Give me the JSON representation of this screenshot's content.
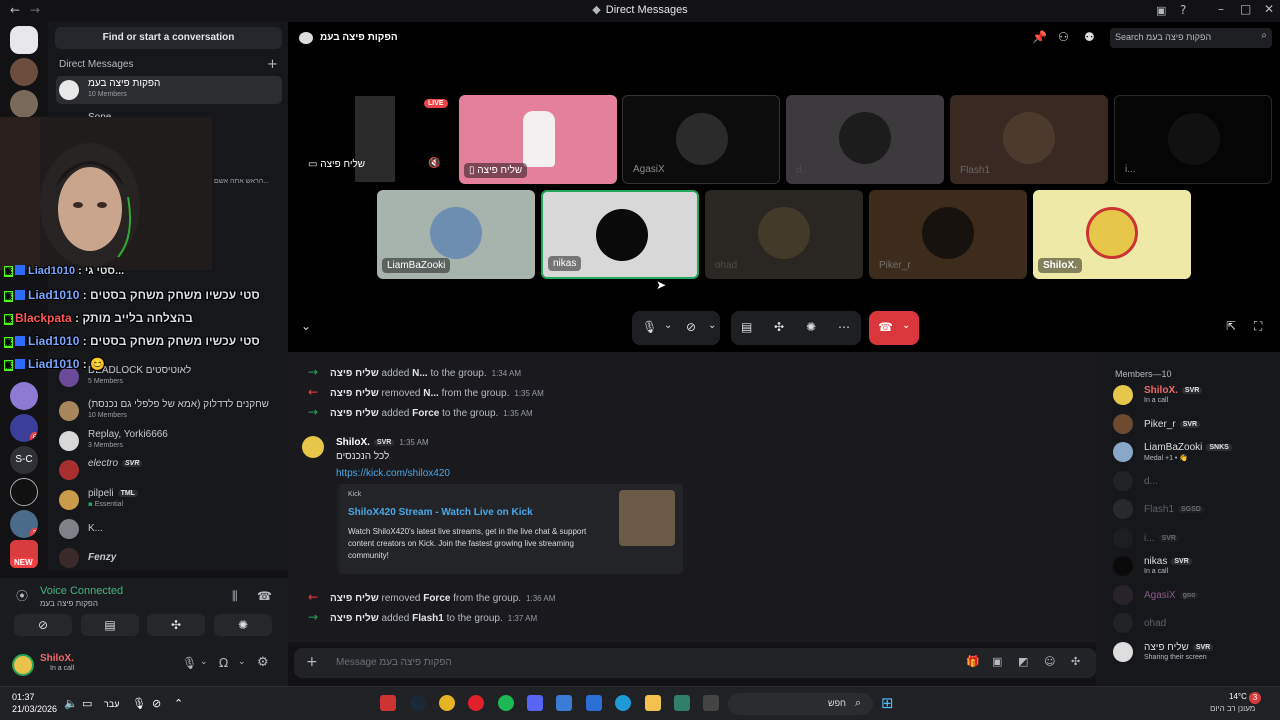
{
  "window": {
    "title": "Direct Messages"
  },
  "server_rail": {
    "servers": [
      {
        "label": "S-C",
        "badge": ""
      },
      {
        "label": "",
        "badge": "6"
      },
      {
        "label": "",
        "badge": "3"
      },
      {
        "label": "NEW",
        "badge": ""
      }
    ]
  },
  "dm_panel": {
    "find_button": "Find or start a conversation",
    "header": "Direct Messages",
    "add_icon": "+",
    "items": [
      {
        "name": "הפקות פיצה בעמ",
        "sub": "10 Members",
        "tag": ""
      },
      {
        "name": "DEADLOCK לאוטיסטים",
        "sub": "5 Members",
        "tag": ""
      },
      {
        "name": "שחקנים לדדלוק (אמא של פלפלי גם נכנסת)",
        "sub": "10 Members",
        "tag": ""
      },
      {
        "name": "Replay, Yorki6666",
        "sub": "3 Members",
        "tag": ""
      },
      {
        "name": "electro",
        "sub": "",
        "tag": "SVR"
      },
      {
        "name": "pilpeli",
        "sub": "Essential",
        "tag": "TML"
      },
      {
        "name": "K...",
        "sub": "",
        "tag": ""
      },
      {
        "name": "Fenzy",
        "sub": "",
        "tag": ""
      }
    ],
    "overlay_partial": [
      "Sone",
      "הראש אתה אשם..."
    ]
  },
  "stream_chat_overlay": [
    {
      "user": "Liad1010",
      "color": "b",
      "msg": "סטי גי..."
    },
    {
      "user": "Liad1010",
      "color": "b",
      "msg": "סטי עכשיו משחק משחק בסטים"
    },
    {
      "user": "Blackpata",
      "color": "r",
      "msg": "בהצלחה בלייב מותק"
    },
    {
      "user": "Liad1010",
      "color": "b",
      "msg": "סטי עכשיו משחק משחק בסטים"
    },
    {
      "user": "Liad1010",
      "color": "b",
      "msg": "😊"
    }
  ],
  "voice": {
    "status": "Voice Connected",
    "channel": "הפקות פיצה בעמ"
  },
  "user_bar": {
    "name": "ShiloX.",
    "status": "In a call"
  },
  "stage": {
    "header_title": "הפקות פיצה בעמ",
    "search_placeholder": "Search הפקות פיצה בעמ",
    "live_badge": "LIVE",
    "screen_share_label": "שליח פיצה",
    "tiles": [
      {
        "name": "שליח פיצה",
        "style": "pink"
      },
      {
        "name": "AgasiX",
        "style": "dim"
      },
      {
        "name": "d...",
        "style": "dim"
      },
      {
        "name": "Flash1",
        "style": "dim"
      },
      {
        "name": "i...",
        "style": "dim"
      },
      {
        "name": "LiamBaZooki",
        "style": "normal"
      },
      {
        "name": "nikas",
        "style": "selected"
      },
      {
        "name": "ohad",
        "style": "dim"
      },
      {
        "name": "Piker_r",
        "style": "dim"
      },
      {
        "name": "ShiloX.",
        "style": "yellow"
      }
    ]
  },
  "chat": {
    "events": [
      {
        "kind": "add",
        "actor": "שליח פיצה",
        "verb": "added",
        "target": "N...",
        "tail": "to the group.",
        "time": "1:34 AM"
      },
      {
        "kind": "remove",
        "actor": "שליח פיצה",
        "verb": "removed",
        "target": "N...",
        "tail": "from the group.",
        "time": "1:35 AM"
      },
      {
        "kind": "add",
        "actor": "שליח פיצה",
        "verb": "added",
        "target": "Force",
        "tail": "to the group.",
        "time": "1:35 AM"
      }
    ],
    "message": {
      "author": "ShiloX.",
      "tag": "SVR",
      "time": "1:35 AM",
      "text": "לכל הנכנסים",
      "link": "https://kick.com/shilox420",
      "embed": {
        "provider": "Kick",
        "title": "ShiloX420 Stream - Watch Live on Kick",
        "description": "Watch ShiloX420's latest live streams, get in the live chat & support content creators on Kick. Join the fastest growing live streaming community!"
      }
    },
    "events2": [
      {
        "kind": "remove",
        "actor": "שליח פיצה",
        "verb": "removed",
        "target": "Force",
        "tail": "from the group.",
        "time": "1:36 AM"
      },
      {
        "kind": "add",
        "actor": "שליח פיצה",
        "verb": "added",
        "target": "Flash1",
        "tail": "to the group.",
        "time": "1:37 AM"
      }
    ],
    "composer_placeholder": "Message הפקות פיצה בעמ"
  },
  "members": {
    "header": "Members—10",
    "list": [
      {
        "name": "ShiloX.",
        "tag": "SVR",
        "status": "In a call",
        "color": "#f0696b",
        "off": false
      },
      {
        "name": "Piker_r",
        "tag": "SVR",
        "status": "",
        "color": "#dbdee1",
        "off": false
      },
      {
        "name": "LiamBaZooki",
        "tag": "SNKS",
        "status": "Medal +1 • 👋",
        "color": "#dbdee1",
        "off": false
      },
      {
        "name": "d...",
        "tag": "",
        "status": "",
        "color": "",
        "off": true
      },
      {
        "name": "Flash1",
        "tag": "SGSD",
        "status": "",
        "color": "",
        "off": true
      },
      {
        "name": "i...",
        "tag": "SVR",
        "status": "",
        "color": "",
        "off": true
      },
      {
        "name": "nikas",
        "tag": "SVR",
        "status": "In a call",
        "color": "#dbdee1",
        "off": false
      },
      {
        "name": "AgasiX",
        "tag": "goo",
        "status": "",
        "color": "#8c5a8c",
        "off": true
      },
      {
        "name": "ohad",
        "tag": "",
        "status": "",
        "color": "",
        "off": true
      },
      {
        "name": "שליח פיצה",
        "tag": "SVR",
        "status": "Sharing their screen",
        "color": "#dbdee1",
        "off": false
      }
    ]
  },
  "taskbar": {
    "time": "01:37",
    "date": "21/03/2026",
    "lang": "עבר",
    "search_text": "חפש",
    "weather_temp": "14°C",
    "weather_desc": "מעונן רב היום",
    "notif_count": "3"
  },
  "colors": {
    "accent": "#5865f2",
    "danger": "#da373c",
    "online": "#23a55a",
    "live": "#ed4245"
  }
}
